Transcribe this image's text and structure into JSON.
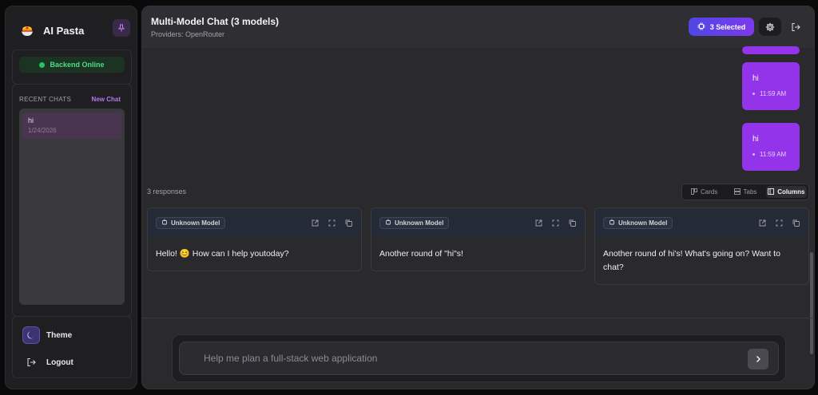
{
  "sidebar": {
    "brand": {
      "name": "AI Pasta",
      "logo_icon": "pasta-bowl-icon"
    },
    "status": {
      "label": "Backend Online",
      "color": "#22c55e"
    },
    "recent": {
      "title": "RECENT CHATS",
      "new_chat_label": "New Chat",
      "items": [
        {
          "title": "hi",
          "date": "1/24/2026"
        }
      ]
    },
    "theme_label": "Theme",
    "logout_label": "Logout"
  },
  "header": {
    "title": "Multi-Model Chat (3 models)",
    "subtitle": "Providers: OpenRouter",
    "selected_label": "3 Selected"
  },
  "messages": [
    {
      "text": "hi",
      "time": "11:59 AM"
    },
    {
      "text": "hi",
      "time": "11:59 AM"
    }
  ],
  "responses": {
    "count_label": "3 responses",
    "views": [
      "Cards",
      "Tabs",
      "Columns"
    ],
    "active_view": "Columns",
    "cards": [
      {
        "model": "Unknown Model",
        "text": "Hello! 😊 How can I help youtoday?"
      },
      {
        "model": "Unknown Model",
        "text": "Another round of \"hi\"s!"
      },
      {
        "model": "Unknown Model",
        "text": "Another round of hi's! What's going on? Want to chat?"
      }
    ]
  },
  "composer": {
    "placeholder": "Help me plan a full-stack web application"
  },
  "colors": {
    "accent": "#9333ea",
    "selected_gradient": "#4f46e5",
    "online": "#22c55e"
  }
}
